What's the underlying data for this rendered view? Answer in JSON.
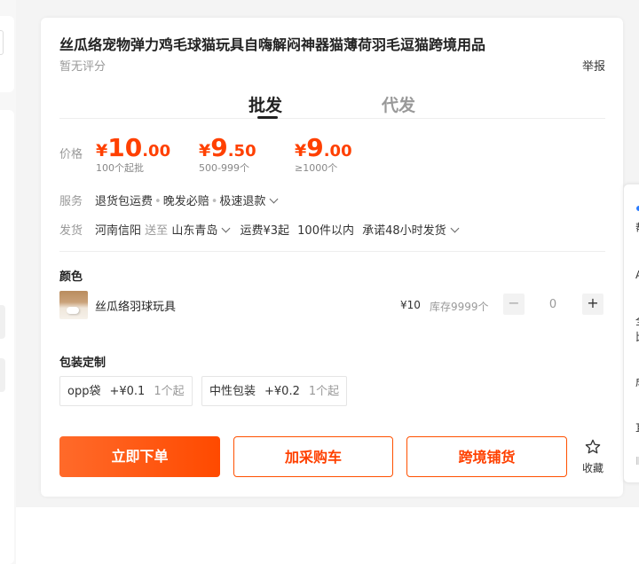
{
  "product": {
    "title": "丝瓜络宠物弹力鸡毛球猫玩具自嗨解闷神器猫薄荷羽毛逗猫跨境用品",
    "rating": "暂无评分",
    "report": "举报"
  },
  "tabs": [
    {
      "label": "批发",
      "active": true
    },
    {
      "label": "代发",
      "active": false
    }
  ],
  "price": {
    "label": "价格",
    "tiers": [
      {
        "currency": "¥",
        "int": "10",
        "dec": ".00",
        "range": "100个起批"
      },
      {
        "currency": "¥",
        "int": "9",
        "dec": ".50",
        "range": "500-999个"
      },
      {
        "currency": "¥",
        "int": "9",
        "dec": ".00",
        "range": "≥1000个"
      }
    ]
  },
  "service": {
    "label": "服务",
    "items": [
      "退货包运费",
      "晚发必赔",
      "极速退款"
    ]
  },
  "shipping": {
    "label": "发货",
    "from": "河南信阳",
    "to_word": "送至",
    "to": "山东青岛",
    "fee": "运费¥3起",
    "qty": "100件以内",
    "promise": "承诺48小时发货"
  },
  "color_section": {
    "title": "颜色",
    "items": [
      {
        "name": "丝瓜络羽球玩具",
        "price": "¥10",
        "stock": "库存9999个",
        "qty": "0",
        "minus": "−",
        "plus": "+"
      }
    ]
  },
  "packaging": {
    "title": "包装定制",
    "options": [
      {
        "name": "opp袋",
        "price": "+¥0.1",
        "min": "1个起"
      },
      {
        "name": "中性包装",
        "price": "+¥0.2",
        "min": "1个起"
      }
    ]
  },
  "actions": {
    "buy": "立即下单",
    "cart": "加采购车",
    "cross": "跨境铺货",
    "favorite": "收藏"
  },
  "right_panel_glyphs": [
    "帮",
    "A",
    "全",
    "比",
    "成",
    "耳",
    "Ⅱ"
  ],
  "colors": {
    "accent": "#ff4000",
    "button_gradient_start": "#ff6a2a",
    "button_gradient_end": "#ff4a00"
  }
}
